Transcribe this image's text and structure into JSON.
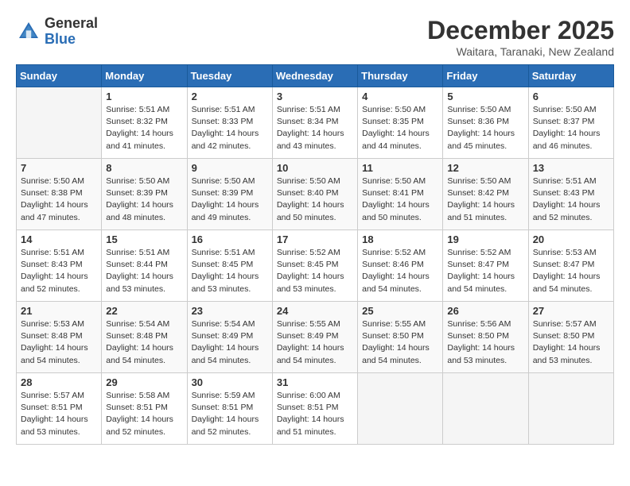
{
  "header": {
    "logo_general": "General",
    "logo_blue": "Blue",
    "month_title": "December 2025",
    "subtitle": "Waitara, Taranaki, New Zealand"
  },
  "weekdays": [
    "Sunday",
    "Monday",
    "Tuesday",
    "Wednesday",
    "Thursday",
    "Friday",
    "Saturday"
  ],
  "weeks": [
    [
      {
        "day": "",
        "info": ""
      },
      {
        "day": "1",
        "info": "Sunrise: 5:51 AM\nSunset: 8:32 PM\nDaylight: 14 hours\nand 41 minutes."
      },
      {
        "day": "2",
        "info": "Sunrise: 5:51 AM\nSunset: 8:33 PM\nDaylight: 14 hours\nand 42 minutes."
      },
      {
        "day": "3",
        "info": "Sunrise: 5:51 AM\nSunset: 8:34 PM\nDaylight: 14 hours\nand 43 minutes."
      },
      {
        "day": "4",
        "info": "Sunrise: 5:50 AM\nSunset: 8:35 PM\nDaylight: 14 hours\nand 44 minutes."
      },
      {
        "day": "5",
        "info": "Sunrise: 5:50 AM\nSunset: 8:36 PM\nDaylight: 14 hours\nand 45 minutes."
      },
      {
        "day": "6",
        "info": "Sunrise: 5:50 AM\nSunset: 8:37 PM\nDaylight: 14 hours\nand 46 minutes."
      }
    ],
    [
      {
        "day": "7",
        "info": "Sunrise: 5:50 AM\nSunset: 8:38 PM\nDaylight: 14 hours\nand 47 minutes."
      },
      {
        "day": "8",
        "info": "Sunrise: 5:50 AM\nSunset: 8:39 PM\nDaylight: 14 hours\nand 48 minutes."
      },
      {
        "day": "9",
        "info": "Sunrise: 5:50 AM\nSunset: 8:39 PM\nDaylight: 14 hours\nand 49 minutes."
      },
      {
        "day": "10",
        "info": "Sunrise: 5:50 AM\nSunset: 8:40 PM\nDaylight: 14 hours\nand 50 minutes."
      },
      {
        "day": "11",
        "info": "Sunrise: 5:50 AM\nSunset: 8:41 PM\nDaylight: 14 hours\nand 50 minutes."
      },
      {
        "day": "12",
        "info": "Sunrise: 5:50 AM\nSunset: 8:42 PM\nDaylight: 14 hours\nand 51 minutes."
      },
      {
        "day": "13",
        "info": "Sunrise: 5:51 AM\nSunset: 8:43 PM\nDaylight: 14 hours\nand 52 minutes."
      }
    ],
    [
      {
        "day": "14",
        "info": "Sunrise: 5:51 AM\nSunset: 8:43 PM\nDaylight: 14 hours\nand 52 minutes."
      },
      {
        "day": "15",
        "info": "Sunrise: 5:51 AM\nSunset: 8:44 PM\nDaylight: 14 hours\nand 53 minutes."
      },
      {
        "day": "16",
        "info": "Sunrise: 5:51 AM\nSunset: 8:45 PM\nDaylight: 14 hours\nand 53 minutes."
      },
      {
        "day": "17",
        "info": "Sunrise: 5:52 AM\nSunset: 8:45 PM\nDaylight: 14 hours\nand 53 minutes."
      },
      {
        "day": "18",
        "info": "Sunrise: 5:52 AM\nSunset: 8:46 PM\nDaylight: 14 hours\nand 54 minutes."
      },
      {
        "day": "19",
        "info": "Sunrise: 5:52 AM\nSunset: 8:47 PM\nDaylight: 14 hours\nand 54 minutes."
      },
      {
        "day": "20",
        "info": "Sunrise: 5:53 AM\nSunset: 8:47 PM\nDaylight: 14 hours\nand 54 minutes."
      }
    ],
    [
      {
        "day": "21",
        "info": "Sunrise: 5:53 AM\nSunset: 8:48 PM\nDaylight: 14 hours\nand 54 minutes."
      },
      {
        "day": "22",
        "info": "Sunrise: 5:54 AM\nSunset: 8:48 PM\nDaylight: 14 hours\nand 54 minutes."
      },
      {
        "day": "23",
        "info": "Sunrise: 5:54 AM\nSunset: 8:49 PM\nDaylight: 14 hours\nand 54 minutes."
      },
      {
        "day": "24",
        "info": "Sunrise: 5:55 AM\nSunset: 8:49 PM\nDaylight: 14 hours\nand 54 minutes."
      },
      {
        "day": "25",
        "info": "Sunrise: 5:55 AM\nSunset: 8:50 PM\nDaylight: 14 hours\nand 54 minutes."
      },
      {
        "day": "26",
        "info": "Sunrise: 5:56 AM\nSunset: 8:50 PM\nDaylight: 14 hours\nand 53 minutes."
      },
      {
        "day": "27",
        "info": "Sunrise: 5:57 AM\nSunset: 8:50 PM\nDaylight: 14 hours\nand 53 minutes."
      }
    ],
    [
      {
        "day": "28",
        "info": "Sunrise: 5:57 AM\nSunset: 8:51 PM\nDaylight: 14 hours\nand 53 minutes."
      },
      {
        "day": "29",
        "info": "Sunrise: 5:58 AM\nSunset: 8:51 PM\nDaylight: 14 hours\nand 52 minutes."
      },
      {
        "day": "30",
        "info": "Sunrise: 5:59 AM\nSunset: 8:51 PM\nDaylight: 14 hours\nand 52 minutes."
      },
      {
        "day": "31",
        "info": "Sunrise: 6:00 AM\nSunset: 8:51 PM\nDaylight: 14 hours\nand 51 minutes."
      },
      {
        "day": "",
        "info": ""
      },
      {
        "day": "",
        "info": ""
      },
      {
        "day": "",
        "info": ""
      }
    ]
  ]
}
